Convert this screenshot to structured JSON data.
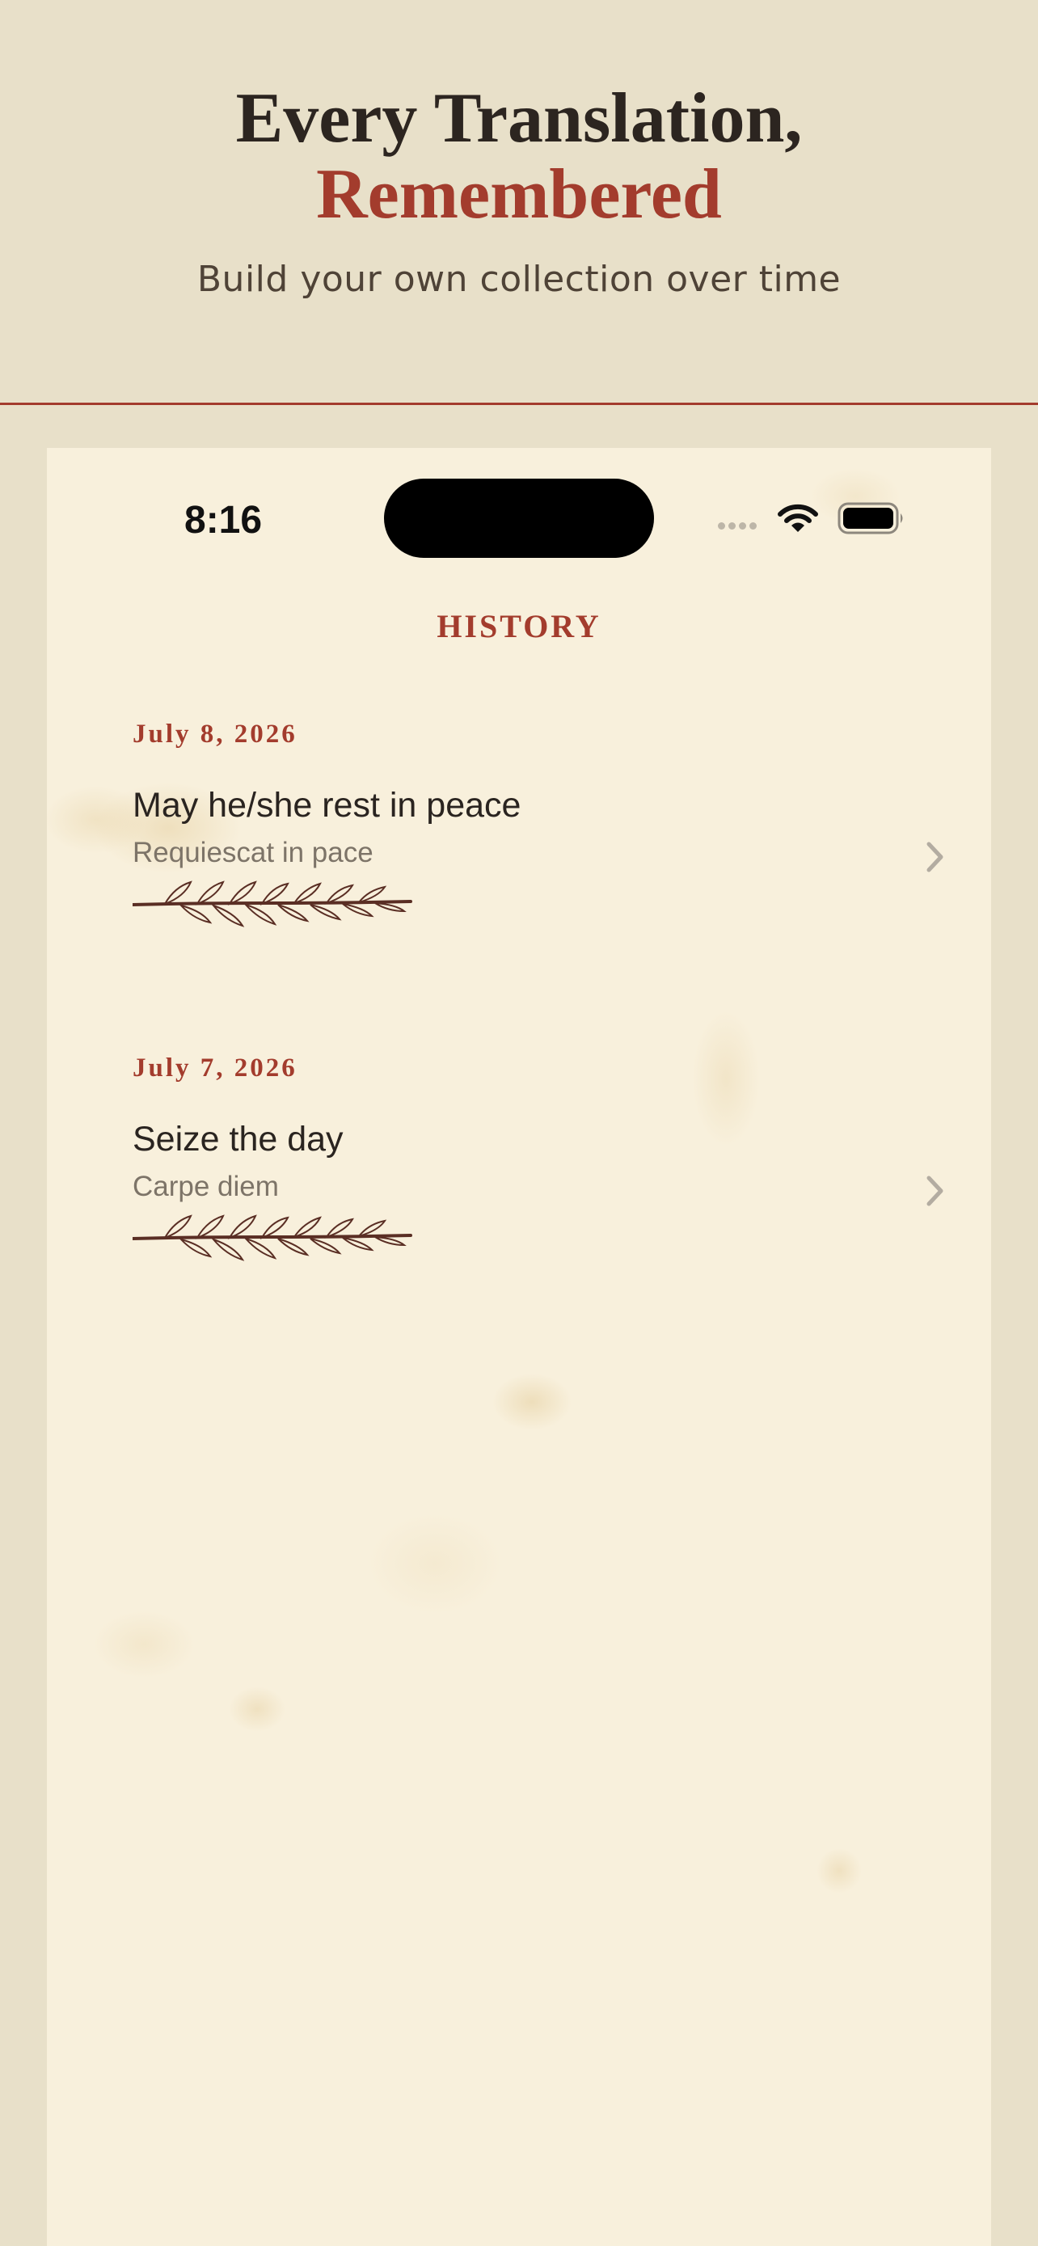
{
  "promo": {
    "headline_line1": "Every Translation,",
    "headline_line2": "Remembered",
    "subtitle": "Build your own collection over time"
  },
  "status_bar": {
    "time": "8:16",
    "icons": [
      "cellular-signal-icon",
      "wifi-icon",
      "battery-icon"
    ]
  },
  "screen": {
    "title": "HISTORY"
  },
  "history": [
    {
      "date": "July 8, 2026",
      "english": "May he/she rest in peace",
      "latin": "Requiescat in pace",
      "icon": "laurel-branch-icon"
    },
    {
      "date": "July 7, 2026",
      "english": "Seize the day",
      "latin": "Carpe diem",
      "icon": "laurel-branch-icon"
    }
  ],
  "colors": {
    "accent": "#a33c2d",
    "page_background": "#e8e0c9",
    "parchment": "#f8f0dc",
    "text_primary": "#2a2420",
    "text_secondary": "#7d7468",
    "chevron": "#b3aca1"
  }
}
